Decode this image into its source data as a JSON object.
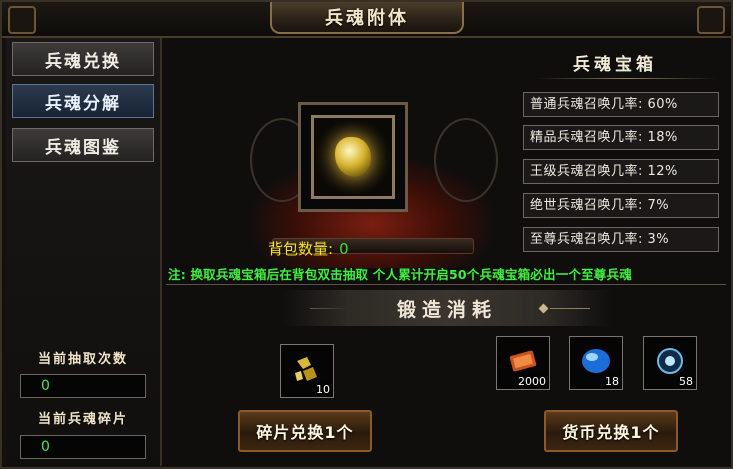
{
  "window": {
    "title": "兵魂附体"
  },
  "sidebar": {
    "items": [
      {
        "label": "兵魂兑换",
        "active": false
      },
      {
        "label": "兵魂分解",
        "active": true
      },
      {
        "label": "兵魂图鉴",
        "active": false
      }
    ],
    "draw_count_label": "当前抽取次数",
    "draw_count_value": "0",
    "fragment_label": "当前兵魂碎片",
    "fragment_value": "0"
  },
  "main": {
    "bag_label": "背包数量:",
    "bag_value": "0",
    "notice": "注: 换取兵魂宝箱后在背包双击抽取 个人累计开启50个兵魂宝箱必出一个至尊兵魂",
    "box": {
      "title": "兵魂宝箱",
      "rates": [
        "普通兵魂召唤几率: 60%",
        "精品兵魂召唤几率: 18%",
        "王级兵魂召唤几率: 12%",
        "绝世兵魂召唤几率: 7%",
        "至尊兵魂召唤几率: 3%"
      ]
    },
    "forge": {
      "title": "锻造消耗",
      "fragment_qty": "10",
      "currency_items": [
        {
          "icon": "scroll-icon",
          "qty": "2000"
        },
        {
          "icon": "blue-gem-icon",
          "qty": "18"
        },
        {
          "icon": "crystal-orb-icon",
          "qty": "58"
        }
      ],
      "fragment_button": "碎片兑换1个",
      "currency_button": "货币兑换1个"
    }
  },
  "colors": {
    "accent_green": "#3ff03f",
    "accent_yellow": "#f2e12a",
    "active_tab": "#182436"
  }
}
